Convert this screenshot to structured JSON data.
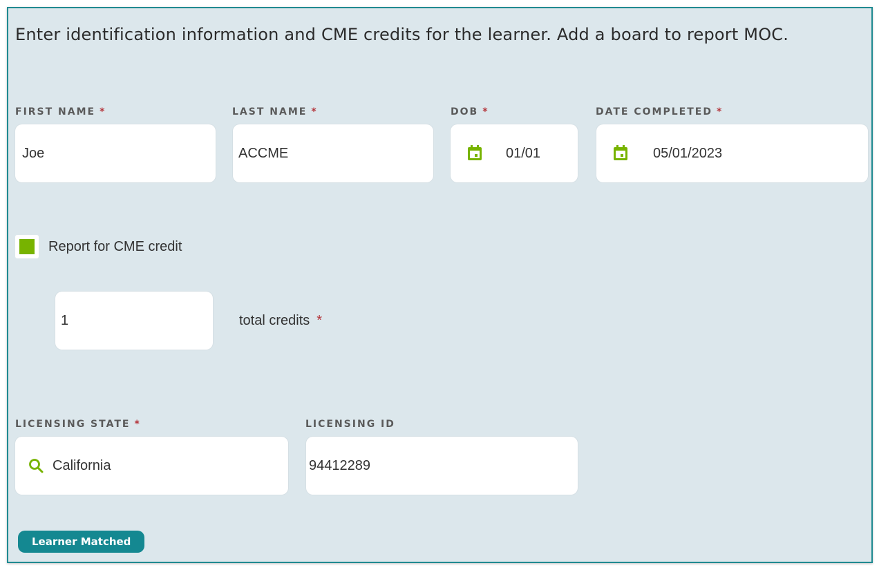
{
  "intro": {
    "text": "Enter identification information and CME credits for the learner. Add a board to report MOC."
  },
  "required_marker": "*",
  "fields": {
    "first_name": {
      "label": "FIRST NAME",
      "value": "Joe"
    },
    "last_name": {
      "label": "LAST NAME",
      "value": "ACCME"
    },
    "dob": {
      "label": "DOB",
      "value": "01/01",
      "icon": "calendar-icon"
    },
    "date_completed": {
      "label": "DATE COMPLETED",
      "value": "05/01/2023",
      "icon": "calendar-icon"
    },
    "licensing_state": {
      "label": "LICENSING STATE",
      "value": "California",
      "icon": "search-icon"
    },
    "licensing_id": {
      "label": "LICENSING ID",
      "value": "94412289"
    }
  },
  "cme": {
    "checkbox_label": "Report for CME credit",
    "checked": true,
    "total_credits_value": "1",
    "total_credits_label": "total credits"
  },
  "status": {
    "badge": "Learner Matched"
  },
  "colors": {
    "panel_bg": "#dce7ec",
    "panel_border": "#1f8a91",
    "accent_green": "#77b300",
    "required_red": "#b4343a",
    "badge_bg": "#148891"
  }
}
